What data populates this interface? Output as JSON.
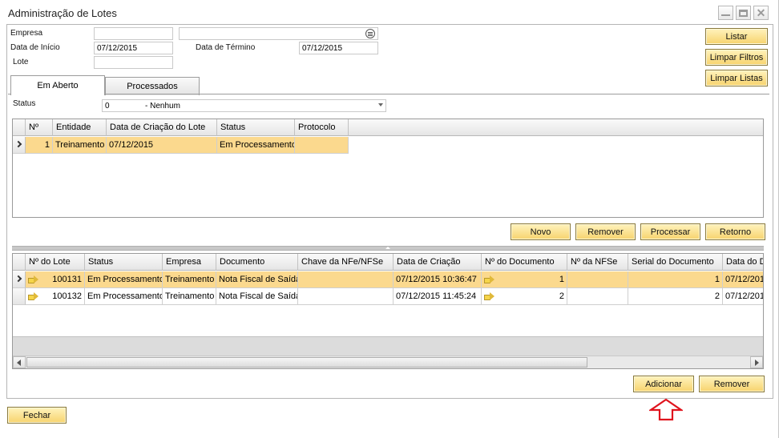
{
  "window": {
    "title": "Administração de Lotes"
  },
  "filters": {
    "empresa_label": "Empresa",
    "empresa_code": "",
    "empresa_name": "",
    "data_inicio_label": "Data de Início",
    "data_inicio_value": "07/12/2015",
    "data_termino_label": "Data de Término",
    "data_termino_value": "07/12/2015",
    "lote_label": "Lote",
    "lote_value": ""
  },
  "side_buttons": {
    "listar": "Listar",
    "limpar_filtros": "Limpar Filtros",
    "limpar_listas": "Limpar Listas"
  },
  "tabs": [
    {
      "label": "Em Aberto",
      "active": true
    },
    {
      "label": "Processados",
      "active": false
    }
  ],
  "status_filter": {
    "label": "Status",
    "code": "0",
    "text": "- Nenhum"
  },
  "lotes_grid": {
    "columns": [
      "Nº",
      "Entidade",
      "Data de Criação do Lote",
      "Status",
      "Protocolo"
    ],
    "rows": [
      {
        "num": "1",
        "entidade": "Treinamento",
        "data": "07/12/2015",
        "status": "Em Processamento",
        "protocolo": ""
      }
    ]
  },
  "lote_buttons": {
    "novo": "Novo",
    "remover": "Remover",
    "processar": "Processar",
    "retorno": "Retorno"
  },
  "docs_grid": {
    "columns": [
      "Nº do Lote",
      "Status",
      "Empresa",
      "Documento",
      "Chave da NFe/NFSe",
      "Data de Criação",
      "Nº do Documento",
      "Nº da NFSe",
      "Serial do Documento",
      "Data do D"
    ],
    "rows": [
      {
        "lote": "100131",
        "status": "Em Processamento",
        "empresa": "Treinamento",
        "documento": "Nota Fiscal de Saída",
        "chave": "",
        "criacao": "07/12/2015 10:36:47",
        "num_doc": "1",
        "nfse": "",
        "serial": "1",
        "data_doc": "07/12/201"
      },
      {
        "lote": "100132",
        "status": "Em Processamento",
        "empresa": "Treinamento",
        "documento": "Nota Fiscal de Saída",
        "chave": "",
        "criacao": "07/12/2015 11:45:24",
        "num_doc": "2",
        "nfse": "",
        "serial": "2",
        "data_doc": "07/12/201"
      }
    ]
  },
  "doc_buttons": {
    "adicionar": "Adicionar",
    "remover": "Remover"
  },
  "footer": {
    "fechar": "Fechar"
  },
  "colors": {
    "button_top": "#fff3bd",
    "button_bottom": "#f7d36d",
    "selected_row": "#fbd98e",
    "annotation_arrow": "#e0141e"
  },
  "icons": {
    "window_minimize": "minimize-icon",
    "window_maximize": "maximize-icon",
    "window_close": "close-icon",
    "lookup": "list-lookup-icon",
    "row_link": "yellow-arrow-icon",
    "annotation": "red-up-arrow-icon"
  }
}
